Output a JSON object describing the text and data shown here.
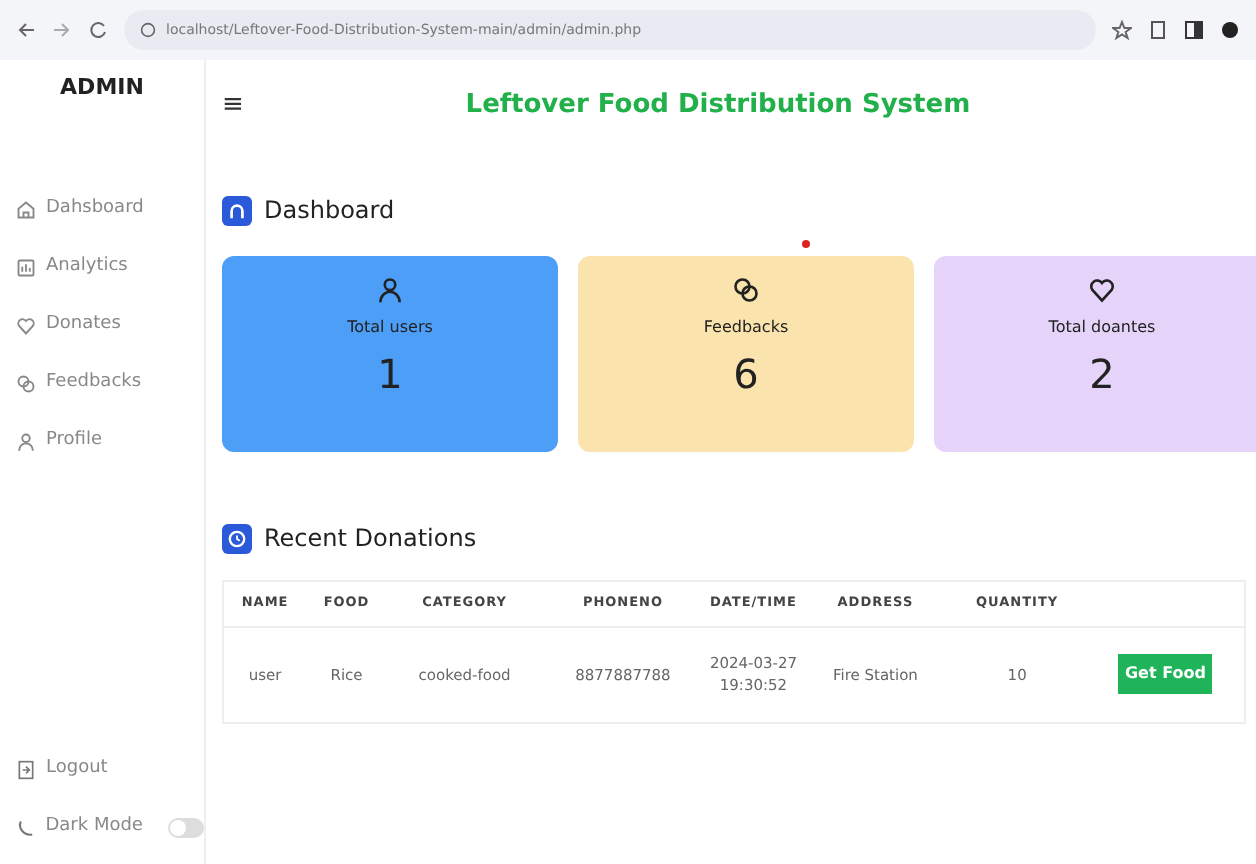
{
  "browser": {
    "url": "localhost/Leftover-Food-Distribution-System-main/admin/admin.php"
  },
  "sidebar": {
    "title": "ADMIN",
    "items": [
      {
        "label": "Dahsboard",
        "kind": "home"
      },
      {
        "label": "Analytics",
        "kind": "chart"
      },
      {
        "label": "Donates",
        "kind": "heart"
      },
      {
        "label": "Feedbacks",
        "kind": "chat"
      },
      {
        "label": "Profile",
        "kind": "user"
      }
    ],
    "logout": "Logout",
    "dark_mode": {
      "label": "Dark Mode",
      "on": false
    }
  },
  "header": {
    "menu_icon": "≡",
    "title": "Leftover Food Distribution System"
  },
  "dashboard": {
    "title": "Dashboard",
    "cards": [
      {
        "label": "Total users",
        "value": "1",
        "kind": "user",
        "color": "#4d9ef7"
      },
      {
        "label": "Feedbacks",
        "value": "6",
        "kind": "chat",
        "color": "#fbe3ad"
      },
      {
        "label": "Total doantes",
        "value": "2",
        "kind": "heart",
        "color": "#e5d3fa"
      }
    ]
  },
  "recent_donations": {
    "title": "Recent Donations",
    "columns": [
      "NAME",
      "FOOD",
      "CATEGORY",
      "PHONENO",
      "DATE/TIME",
      "ADDRESS",
      "QUANTITY"
    ],
    "rows": [
      {
        "cells": [
          "user",
          "Rice",
          "cooked-food",
          "8877887788",
          "2024-03-27 19:30:52",
          "Fire Station",
          "10"
        ],
        "action": "Get Food"
      }
    ]
  }
}
